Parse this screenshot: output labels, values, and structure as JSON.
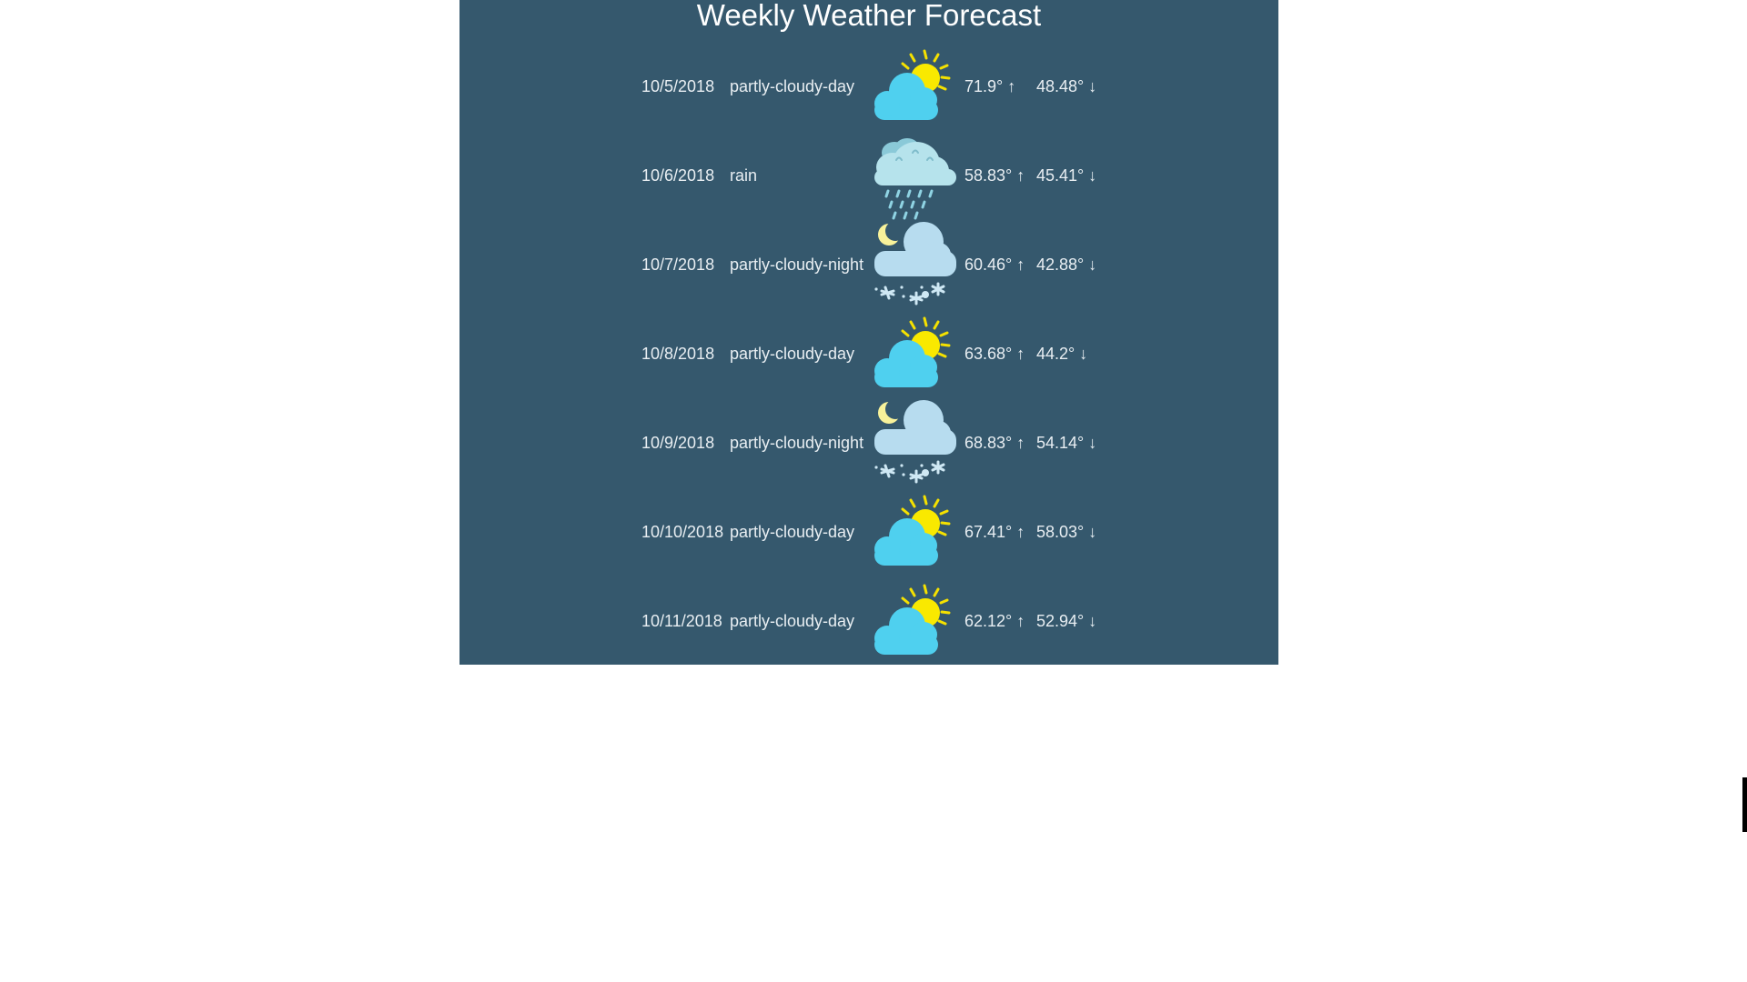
{
  "page": {
    "title": "Weekly Weather Forecast",
    "background": "#35586d"
  },
  "days": [
    {
      "date": "10/5/2018",
      "summary": "partly-cloudy-day",
      "icon": "partly-cloudy-day-icon",
      "high": "71.9° ↑",
      "low": "48.48° ↓"
    },
    {
      "date": "10/6/2018",
      "summary": "rain",
      "icon": "rain-icon",
      "high": "58.83° ↑",
      "low": "45.41° ↓"
    },
    {
      "date": "10/7/2018",
      "summary": "partly-cloudy-night",
      "icon": "partly-cloudy-night-icon",
      "high": "60.46° ↑",
      "low": "42.88° ↓"
    },
    {
      "date": "10/8/2018",
      "summary": "partly-cloudy-day",
      "icon": "partly-cloudy-day-icon",
      "high": "63.68° ↑",
      "low": "44.2° ↓"
    },
    {
      "date": "10/9/2018",
      "summary": "partly-cloudy-night",
      "icon": "partly-cloudy-night-icon",
      "high": "68.83° ↑",
      "low": "54.14° ↓"
    },
    {
      "date": "10/10/2018",
      "summary": "partly-cloudy-day",
      "icon": "partly-cloudy-day-icon",
      "high": "67.41° ↑",
      "low": "58.03° ↓"
    },
    {
      "date": "10/11/2018",
      "summary": "partly-cloudy-day",
      "icon": "partly-cloudy-day-icon",
      "high": "62.12° ↑",
      "low": "52.94° ↓"
    }
  ]
}
